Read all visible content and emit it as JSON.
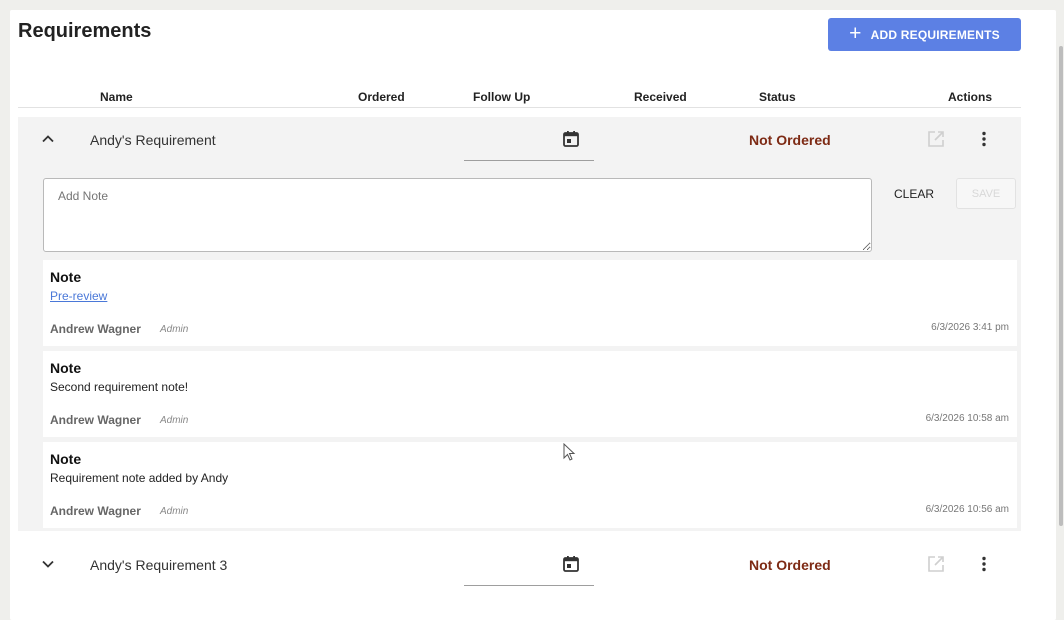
{
  "page": {
    "title": "Requirements",
    "add_button_label": "ADD REQUIREMENTS"
  },
  "table": {
    "headers": {
      "name": "Name",
      "ordered": "Ordered",
      "follow_up": "Follow Up",
      "received": "Received",
      "status": "Status",
      "actions": "Actions"
    }
  },
  "requirements": [
    {
      "name": "Andy's Requirement",
      "status": "Not Ordered",
      "expanded": true
    },
    {
      "name": "Andy's Requirement 3",
      "status": "Not Ordered",
      "expanded": false
    }
  ],
  "note_editor": {
    "placeholder": "Add Note",
    "clear_label": "CLEAR",
    "save_label": "SAVE"
  },
  "notes": [
    {
      "heading": "Note",
      "text": "Pre-review",
      "is_link": true,
      "author": "Andrew Wagner",
      "role": "Admin",
      "time": "6/3/2026 3:41 pm"
    },
    {
      "heading": "Note",
      "text": "Second requirement note!",
      "is_link": false,
      "author": "Andrew Wagner",
      "role": "Admin",
      "time": "6/3/2026 10:58 am"
    },
    {
      "heading": "Note",
      "text": "Requirement note added by Andy",
      "is_link": false,
      "author": "Andrew Wagner",
      "role": "Admin",
      "time": "6/3/2026 10:56 am"
    }
  ],
  "colors": {
    "accent": "#5c80e4",
    "status_not_ordered": "#7d2a14",
    "link": "#4a78d8"
  },
  "icons": {
    "add": "plus-icon",
    "collapse": "chevron-up-icon",
    "expand": "chevron-down-icon",
    "date": "calendar-icon",
    "open": "open-in-new-icon",
    "menu": "more-vert-icon"
  }
}
